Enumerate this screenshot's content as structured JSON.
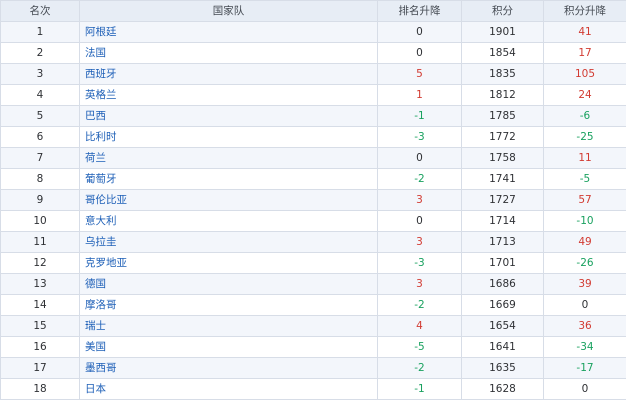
{
  "table": {
    "headers": [
      "名次",
      "国家队",
      "排名升降",
      "积分",
      "积分升降"
    ],
    "rows": [
      {
        "rank": "1",
        "team": "阿根廷",
        "change": "0",
        "points": "1901",
        "delta": "41"
      },
      {
        "rank": "2",
        "team": "法国",
        "change": "0",
        "points": "1854",
        "delta": "17"
      },
      {
        "rank": "3",
        "team": "西班牙",
        "change": "5",
        "points": "1835",
        "delta": "105"
      },
      {
        "rank": "4",
        "team": "英格兰",
        "change": "1",
        "points": "1812",
        "delta": "24"
      },
      {
        "rank": "5",
        "team": "巴西",
        "change": "-1",
        "points": "1785",
        "delta": "-6"
      },
      {
        "rank": "6",
        "team": "比利时",
        "change": "-3",
        "points": "1772",
        "delta": "-25"
      },
      {
        "rank": "7",
        "team": "荷兰",
        "change": "0",
        "points": "1758",
        "delta": "11"
      },
      {
        "rank": "8",
        "team": "葡萄牙",
        "change": "-2",
        "points": "1741",
        "delta": "-5"
      },
      {
        "rank": "9",
        "team": "哥伦比亚",
        "change": "3",
        "points": "1727",
        "delta": "57"
      },
      {
        "rank": "10",
        "team": "意大利",
        "change": "0",
        "points": "1714",
        "delta": "-10"
      },
      {
        "rank": "11",
        "team": "乌拉圭",
        "change": "3",
        "points": "1713",
        "delta": "49"
      },
      {
        "rank": "12",
        "team": "克罗地亚",
        "change": "-3",
        "points": "1701",
        "delta": "-26"
      },
      {
        "rank": "13",
        "team": "德国",
        "change": "3",
        "points": "1686",
        "delta": "39"
      },
      {
        "rank": "14",
        "team": "摩洛哥",
        "change": "-2",
        "points": "1669",
        "delta": "0"
      },
      {
        "rank": "15",
        "team": "瑞士",
        "change": "4",
        "points": "1654",
        "delta": "36"
      },
      {
        "rank": "16",
        "team": "美国",
        "change": "-5",
        "points": "1641",
        "delta": "-34"
      },
      {
        "rank": "17",
        "team": "墨西哥",
        "change": "-2",
        "points": "1635",
        "delta": "-17"
      },
      {
        "rank": "18",
        "team": "日本",
        "change": "-1",
        "points": "1628",
        "delta": "0"
      }
    ]
  },
  "colors": {
    "positive": "#d23b32",
    "negative": "#19a15f",
    "team_link": "#1d5fb7",
    "header_bg": "#e7edf5",
    "row_alt_bg": "#f3f6fb",
    "border": "#d7dde7"
  }
}
